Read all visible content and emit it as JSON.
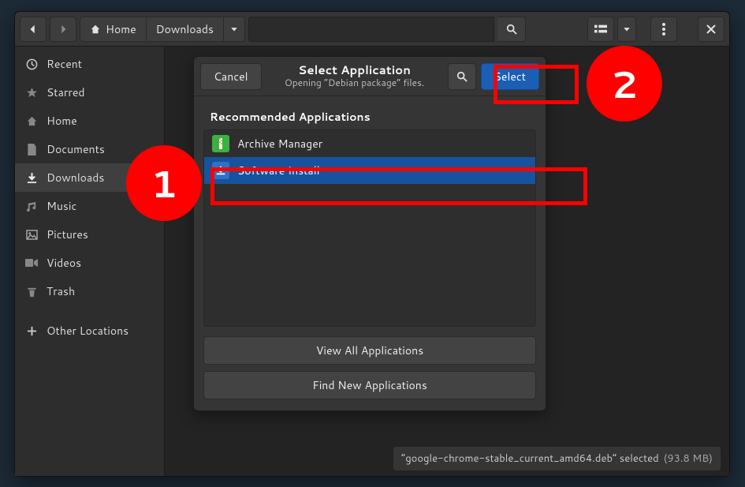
{
  "breadcrumb": {
    "home": "Home",
    "downloads": "Downloads"
  },
  "sidebar": {
    "items": [
      {
        "label": "Recent"
      },
      {
        "label": "Starred"
      },
      {
        "label": "Home"
      },
      {
        "label": "Documents"
      },
      {
        "label": "Downloads"
      },
      {
        "label": "Music"
      },
      {
        "label": "Pictures"
      },
      {
        "label": "Videos"
      },
      {
        "label": "Trash"
      },
      {
        "label": "Other Locations"
      }
    ]
  },
  "dialog": {
    "cancel": "Cancel",
    "title": "Select Application",
    "subtitle": "Opening “Debian package” files.",
    "select": "Select",
    "section": "Recommended Applications",
    "apps": [
      {
        "label": "Archive Manager"
      },
      {
        "label": "Software Install"
      }
    ],
    "view_all": "View All Applications",
    "find_new": "Find New Applications"
  },
  "status": {
    "text": "“google-chrome-stable_current_amd64.deb” selected",
    "size": "(93.8 MB)"
  },
  "annotations": {
    "n1": "1",
    "n2": "2"
  }
}
